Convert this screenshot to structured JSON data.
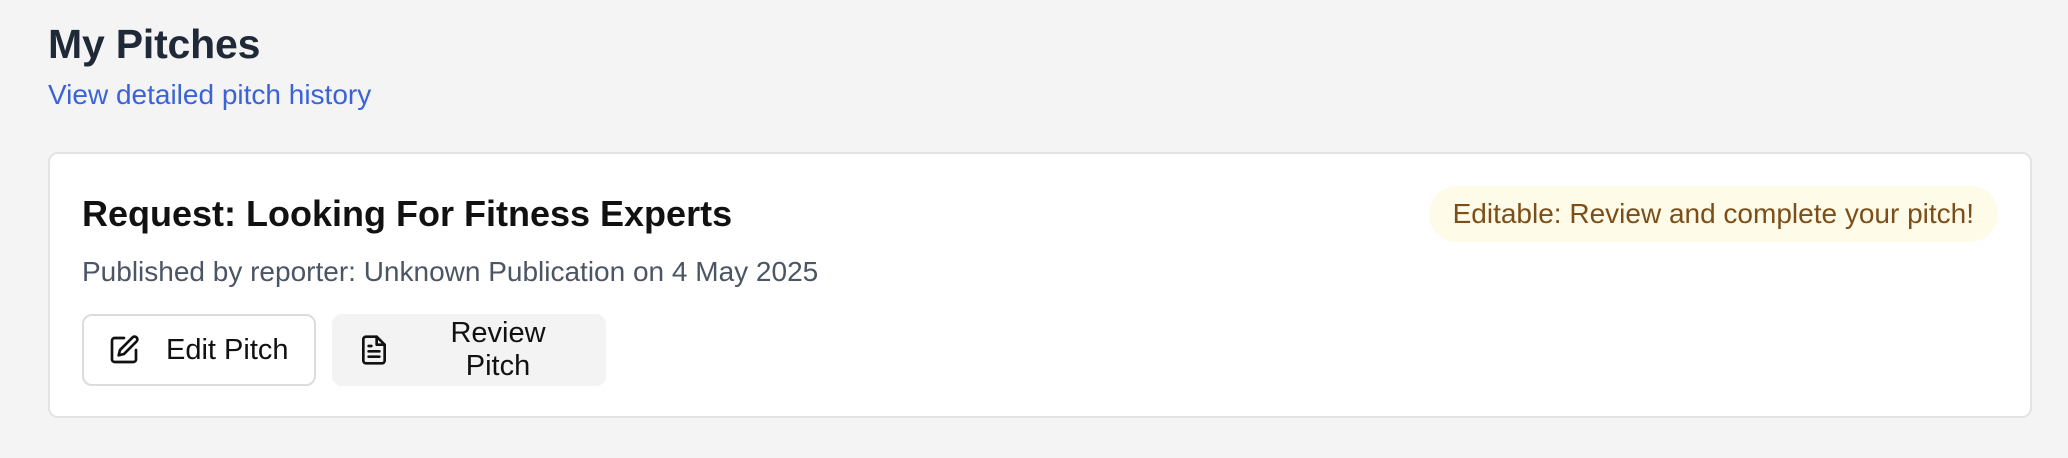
{
  "header": {
    "title": "My Pitches",
    "history_link": "View detailed pitch history"
  },
  "pitch_card": {
    "title": "Request: Looking For Fitness Experts",
    "status_badge": "Editable: Review and complete your pitch!",
    "meta": "Published by reporter: Unknown Publication on 4 May 2025",
    "actions": {
      "edit_label": "Edit Pitch",
      "edit_icon": "edit-icon",
      "review_label": "Review Pitch",
      "review_icon": "document-icon"
    }
  },
  "colors": {
    "background": "#f4f4f4",
    "link": "#3b63d8",
    "badge_bg": "#fefbe8",
    "badge_text": "#7c4f1a",
    "title_text": "#1f2937",
    "meta_text": "#4b5563"
  }
}
